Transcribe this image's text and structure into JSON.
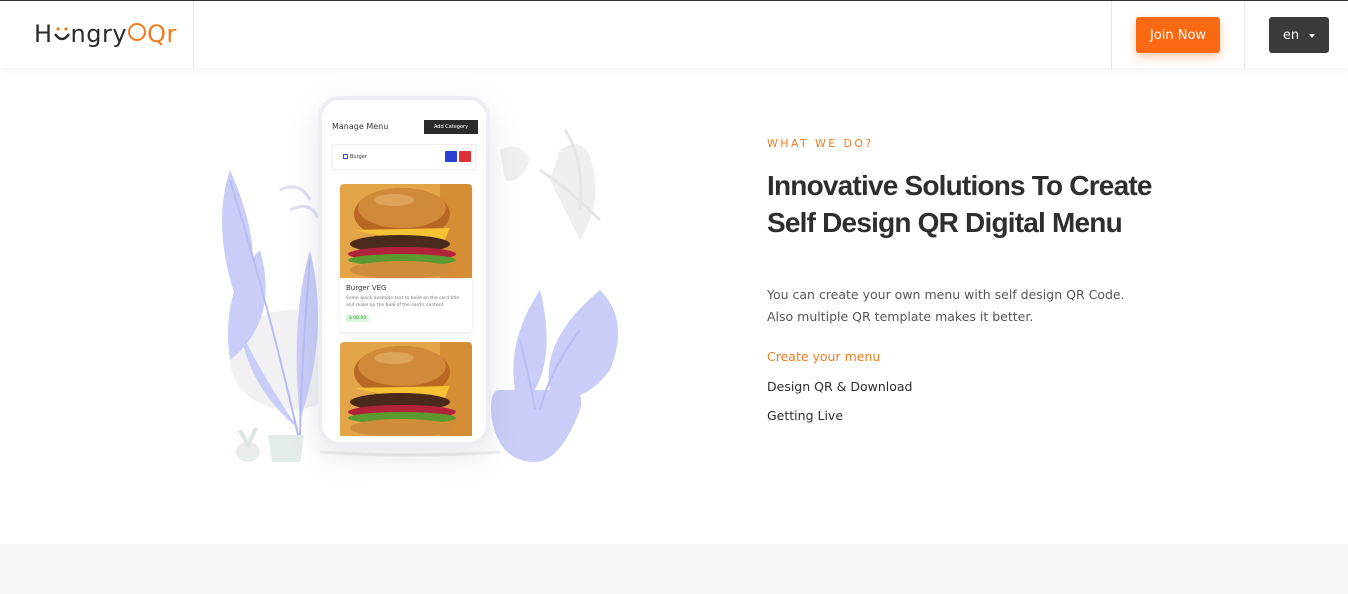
{
  "header": {
    "logo": {
      "part1": "H",
      "part2": "ngry",
      "part3": "Qr"
    },
    "join_label": "Join Now",
    "lang_label": "en"
  },
  "phone": {
    "title": "Manage Menu",
    "add_label": "Add Category",
    "category": "Burger",
    "item": {
      "name": "Burger VEG",
      "desc": "Some quick example text to build on the card title and make up the bulk of the card's content.",
      "price": "$ 00.00"
    }
  },
  "section": {
    "eyebrow": "WHAT WE DO?",
    "headline": "Innovative Solutions To Create Self Design QR Digital Menu",
    "description": "You can create your own menu with self design QR Code. Also multiple QR template makes it better.",
    "steps": [
      "Create your menu",
      "Design QR & Download",
      "Getting Live"
    ]
  },
  "colors": {
    "accent": "#f07c1f",
    "join_button": "#fb6a13",
    "lang_button": "#3b3b3b",
    "plant": "#c9cdf7"
  }
}
